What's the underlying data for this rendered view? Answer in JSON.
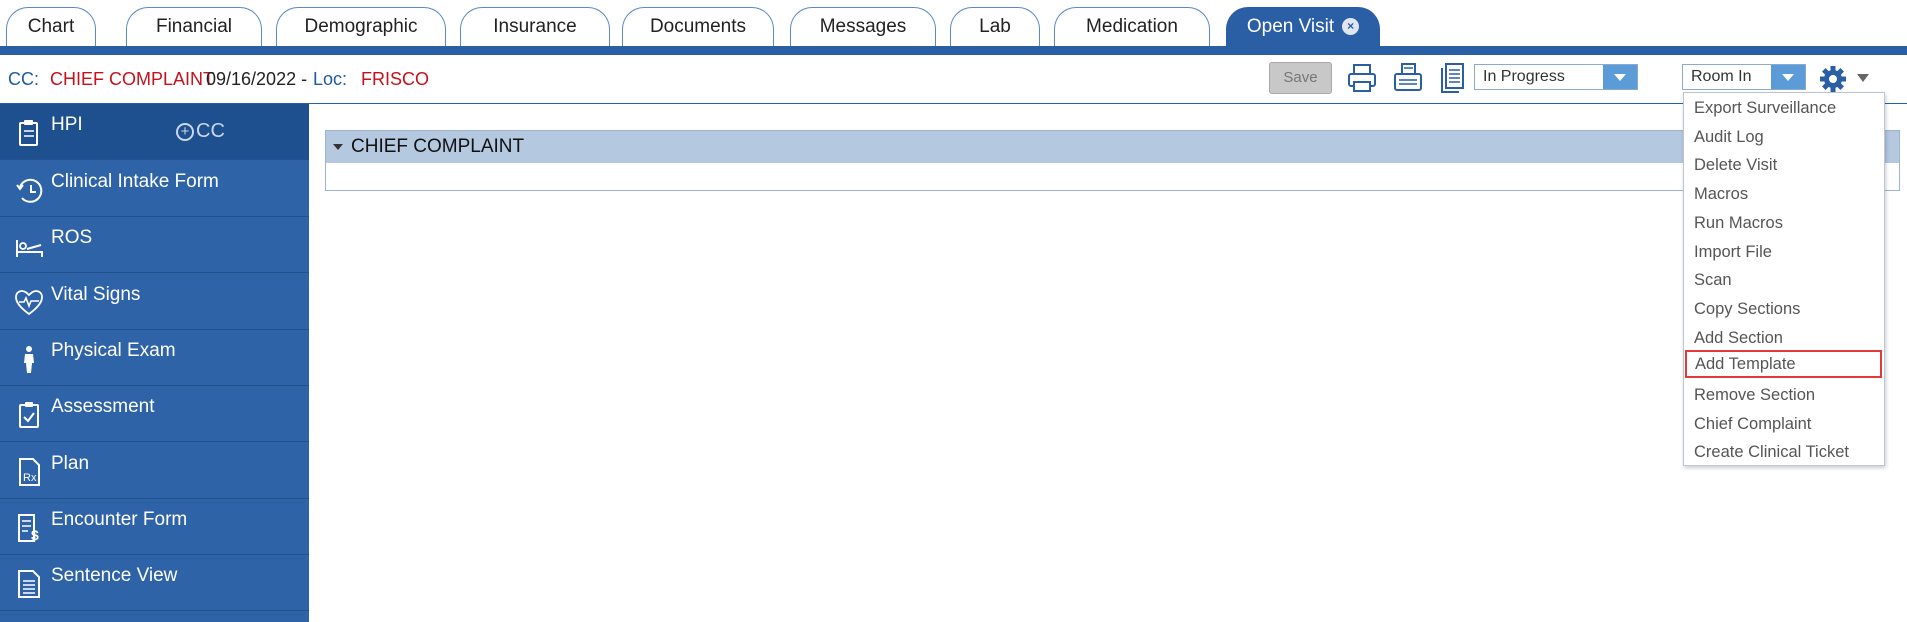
{
  "tabs": [
    {
      "label": "Chart",
      "active": false
    },
    {
      "label": "Financial",
      "active": false
    },
    {
      "label": "Demographic",
      "active": false
    },
    {
      "label": "Insurance",
      "active": false
    },
    {
      "label": "Documents",
      "active": false
    },
    {
      "label": "Messages",
      "active": false
    },
    {
      "label": "Lab",
      "active": false
    },
    {
      "label": "Medication",
      "active": false
    },
    {
      "label": "Open Visit",
      "active": true
    }
  ],
  "header": {
    "cc_label": "CC:",
    "chief_complaint": "CHIEF COMPLAINT",
    "date": "09/16/2022 -",
    "loc_label": "Loc:",
    "location": "FRISCO",
    "save_label": "Save",
    "status_select": "In Progress",
    "room_select": "Room In"
  },
  "sidebar": {
    "cc_button": "CC",
    "items": [
      {
        "label": "HPI",
        "icon": "clipboard-icon",
        "active": true
      },
      {
        "label": "Clinical Intake Form",
        "icon": "clock-icon"
      },
      {
        "label": "ROS",
        "icon": "bed-icon"
      },
      {
        "label": "Vital Signs",
        "icon": "heartbeat-icon"
      },
      {
        "label": "Physical Exam",
        "icon": "person-icon"
      },
      {
        "label": "Assessment",
        "icon": "clipboard-check-icon"
      },
      {
        "label": "Plan",
        "icon": "rx-icon"
      },
      {
        "label": "Encounter Form",
        "icon": "dollar-document-icon"
      },
      {
        "label": "Sentence View",
        "icon": "document-lines-icon"
      }
    ]
  },
  "main": {
    "section_title": "CHIEF COMPLAINT"
  },
  "menu": {
    "items": [
      "Export Surveillance",
      "Audit Log",
      "Delete Visit",
      "Macros",
      "Run Macros",
      "Import File",
      "Scan",
      "Copy Sections",
      "Add Section",
      "Add Template",
      "Remove Section",
      "Chief Complaint",
      "Create Clinical Ticket"
    ],
    "highlighted": "Add Template"
  },
  "colors": {
    "brand_blue": "#2a5fa6",
    "sidebar_blue": "#2e63a8",
    "header_red": "#c4121a",
    "highlight_red": "#e23a3a"
  }
}
